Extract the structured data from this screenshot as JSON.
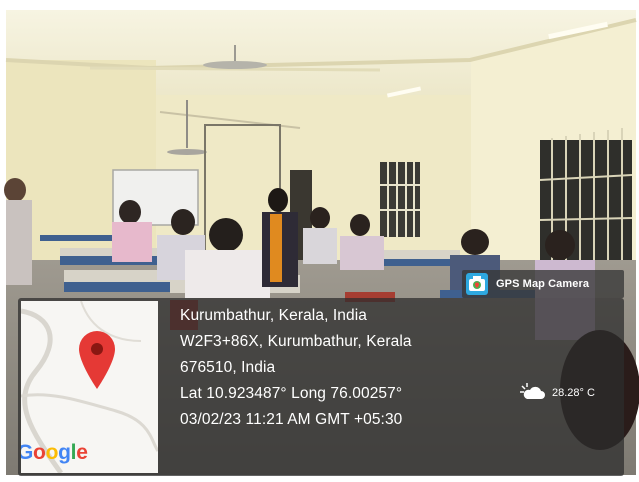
{
  "badge": {
    "label": "GPS Map Camera",
    "icon": "gps-map-camera-icon"
  },
  "map": {
    "provider": "Google",
    "icon": "map-pin-icon"
  },
  "location": {
    "lines": [
      "Kurumbathur, Kerala, India",
      "W2F3+86X, Kurumbathur, Kerala",
      "676510, India",
      "Lat 10.923487° Long 76.00257°",
      "03/02/23 11:21 AM GMT +05:30"
    ]
  },
  "weather": {
    "temperature": "28.28° C",
    "icon": "partly-cloudy-icon"
  },
  "colors": {
    "pin": "#e53935",
    "overlay": "#2d2d2d",
    "wall": "#f1edd3",
    "desk_blue": "#3d5f8d",
    "google_blue": "#4285f4",
    "google_red": "#ea4335",
    "google_yellow": "#fbbc05",
    "google_green": "#34a853"
  }
}
